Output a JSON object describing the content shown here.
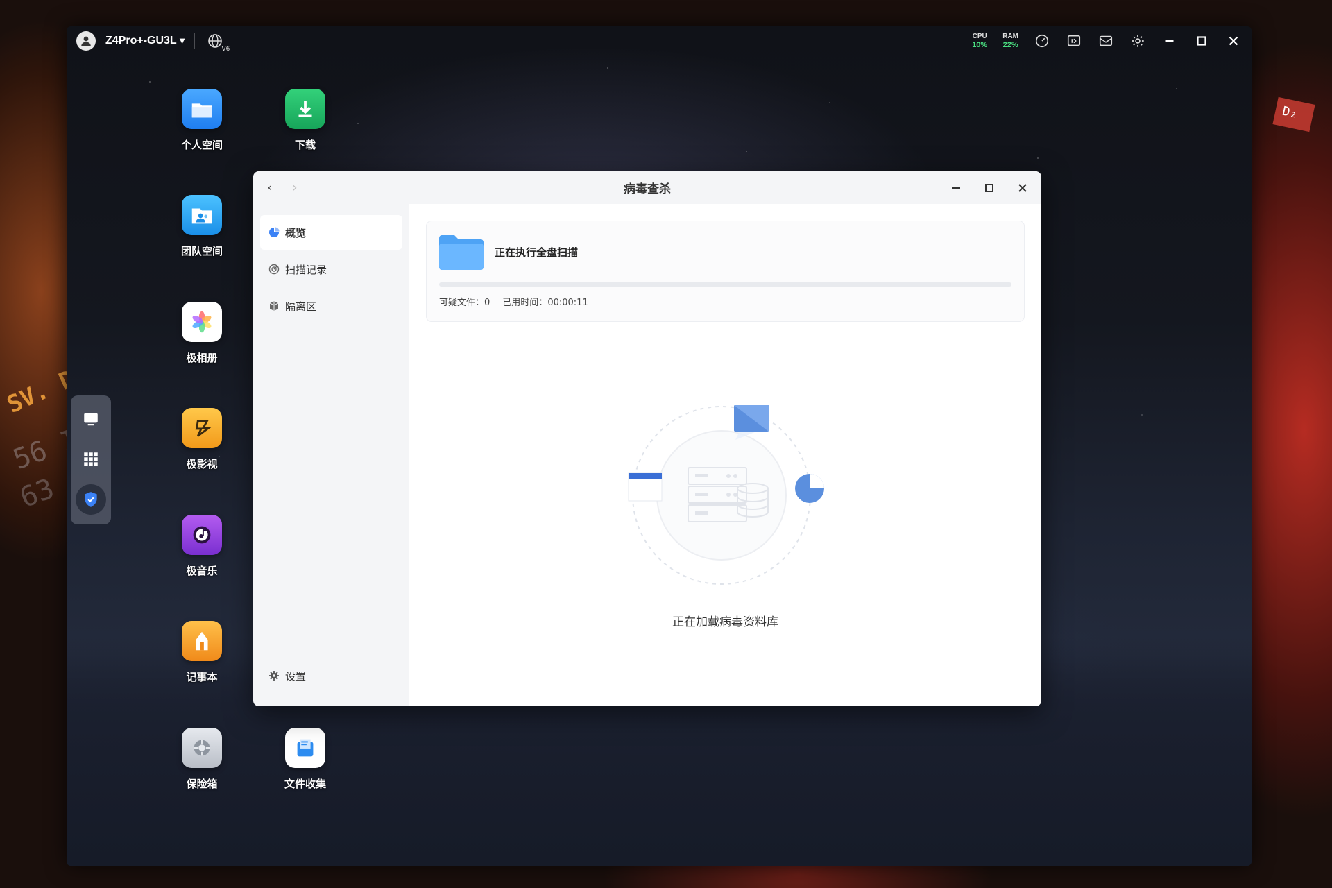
{
  "topbar": {
    "device_name": "Z4Pro+-GU3L",
    "ipv6_badge": "V6",
    "cpu_label": "CPU",
    "cpu_value": "10%",
    "ram_label": "RAM",
    "ram_value": "22%"
  },
  "desktop_apps": [
    {
      "label": "个人空间",
      "icon": "folder-icon",
      "color": "#2f8df5"
    },
    {
      "label": "下载",
      "icon": "download-icon",
      "color": "#23b85f"
    },
    {
      "label": "团队空间",
      "icon": "team-folder-icon",
      "color": "#1ea0f0"
    },
    {
      "label": "极相册",
      "icon": "photos-flower-icon",
      "color": "#ffffff"
    },
    {
      "label": "极影视",
      "icon": "video-icon",
      "color": "#f5a623"
    },
    {
      "label": "极音乐",
      "icon": "music-icon",
      "color": "#8b3fd9"
    },
    {
      "label": "记事本",
      "icon": "notepad-icon",
      "color": "#f7a72b"
    },
    {
      "label": "保险箱",
      "icon": "safe-icon",
      "color": "#c9cdd4"
    },
    {
      "label": "文件收集",
      "icon": "file-collect-icon",
      "color": "#ffffff"
    }
  ],
  "dock": [
    {
      "icon": "monitor-icon"
    },
    {
      "icon": "app-grid-icon"
    },
    {
      "icon": "shield-icon",
      "active": true
    }
  ],
  "window": {
    "title": "病毒查杀",
    "sidebar": {
      "items": [
        {
          "label": "概览",
          "icon": "overview-icon",
          "active": true
        },
        {
          "label": "扫描记录",
          "icon": "scan-record-icon"
        },
        {
          "label": "隔离区",
          "icon": "quarantine-icon"
        }
      ],
      "settings_label": "设置"
    },
    "scan": {
      "status": "正在执行全盘扫描",
      "progress": 0.0,
      "suspicious_label": "可疑文件：",
      "suspicious_value": "0",
      "elapsed_label": "已用时间：",
      "elapsed_value": "00:00:11"
    },
    "loading_text": "正在加载病毒资料库"
  },
  "colors": {
    "accent": "#3b82f6",
    "stat_green": "#4ade80"
  }
}
